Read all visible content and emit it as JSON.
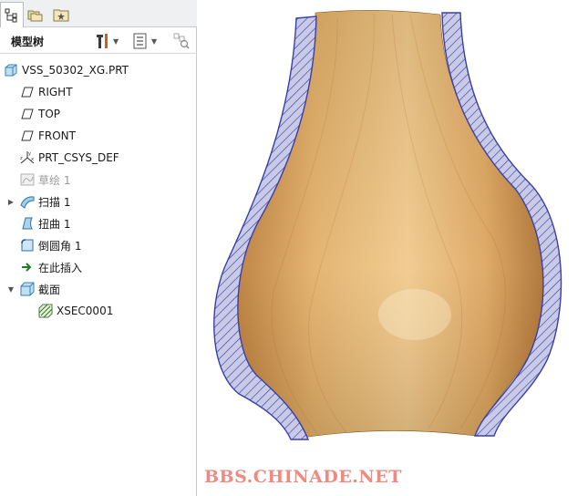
{
  "panel": {
    "tree_title": "模型树"
  },
  "tree": {
    "items": [
      {
        "label": "VSS_50302_XG.PRT",
        "icon": "part-icon"
      },
      {
        "label": "RIGHT",
        "icon": "datum-plane-icon"
      },
      {
        "label": "TOP",
        "icon": "datum-plane-icon"
      },
      {
        "label": "FRONT",
        "icon": "datum-plane-icon"
      },
      {
        "label": "PRT_CSYS_DEF",
        "icon": "coordinate-system-icon"
      },
      {
        "label": "草绘 1",
        "icon": "sketch-icon",
        "state": "suppressed"
      },
      {
        "label": "扫描 1",
        "icon": "sweep-icon",
        "expandable": true
      },
      {
        "label": "扭曲 1",
        "icon": "warp-icon"
      },
      {
        "label": "倒圆角 1",
        "icon": "round-icon"
      },
      {
        "label": "在此插入",
        "icon": "insert-here-arrow-icon"
      },
      {
        "label": "截面",
        "icon": "section-folder-icon",
        "expanded": true
      },
      {
        "label": "XSEC0001",
        "icon": "cross-section-icon"
      }
    ]
  },
  "viewport": {
    "watermark": "BBS.CHINADE.NET",
    "vase_color": "#d9a45a",
    "section_hatch_color": "#3a3fa8",
    "section_fill_color": "#c9cbe6"
  }
}
